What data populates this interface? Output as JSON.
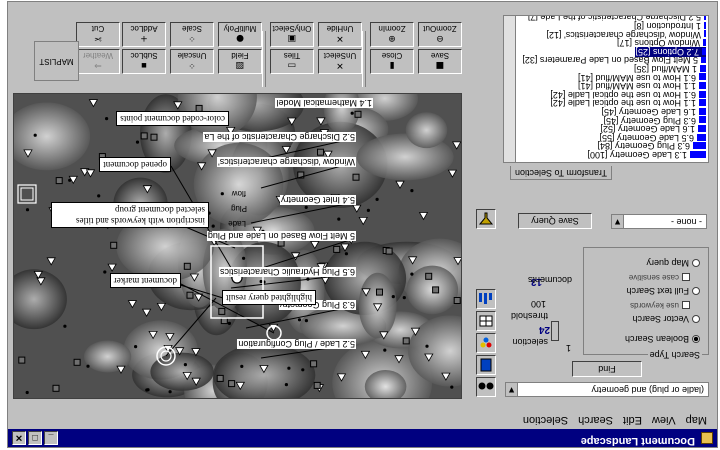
{
  "window": {
    "title": "Document Landscape"
  },
  "titlebar_buttons": {
    "minimize": "_",
    "maximize": "□",
    "close": "✕"
  },
  "menubar": {
    "items": [
      "Map",
      "View",
      "Edit",
      "Search",
      "Selection"
    ]
  },
  "landscape": {
    "doc_labels": [
      "1.4 Mathematical Model",
      "5.2 Discharge Characteristic of the La",
      "Window 'discharge characteristics'",
      "5.4 Inlet Geometry",
      "5 Melt Flow Based on Lade and Plug",
      "6.5 Plug Hydraulic Characteristics",
      "6.3 Plug Geometry",
      "5.2 Lade / Plug Configuration"
    ],
    "annotations": {
      "color_coded": "color-coded document points",
      "opened": "opened document",
      "inscription": "inscription with keywords and titles",
      "selected_group": "selected document group",
      "marker": "document marker",
      "highlighted": "highlighted query result"
    },
    "inset_labels": [
      "Lade",
      "Plug",
      "flow"
    ]
  },
  "side_icons": [
    "binoculars-icon",
    "book-icon",
    "palette-icon",
    "table-icon",
    "chart-icon",
    "filter-icon"
  ],
  "panel": {
    "query_value": "(ladle or plug) and geometry",
    "find_label": "Find",
    "search_type_title": "Search Type",
    "search_types": [
      {
        "label": "Boolean Search",
        "selected": true
      },
      {
        "label": "Vector Search",
        "selected": false
      },
      {
        "label": "Full text Search",
        "selected": false
      },
      {
        "label": "Map query",
        "selected": false
      }
    ],
    "check_keywords": "use keywords",
    "check_case": "case sensitive",
    "selection_label": "selection",
    "selection_value": "24",
    "threshold_label": "threshold",
    "threshold_value": "100",
    "documents_label": "documents",
    "documents_value": "13",
    "small_value": "1",
    "save_query_label": "Save Query",
    "none_value": "- none -",
    "tab_label": "Transform To Selection",
    "list_items": [
      {
        "label": "1.3 Lade Geometry [100]",
        "bar": 100,
        "selected": false
      },
      {
        "label": "6.3 Plug Geometry [84]",
        "bar": 84,
        "selected": false
      },
      {
        "label": "6.5 Lade Geometry [55]",
        "bar": 55,
        "selected": false
      },
      {
        "label": "1.6 Lade Geometry [52]",
        "bar": 52,
        "selected": false
      },
      {
        "label": "6.3 Plug Geometry [45]",
        "bar": 45,
        "selected": false
      },
      {
        "label": "1.6 Lade Geometry [45]",
        "bar": 45,
        "selected": false
      },
      {
        "label": "1.1 How to use the optical Ladle [42]",
        "bar": 42,
        "selected": false
      },
      {
        "label": "6.1 How to use the optical Ladle [42]",
        "bar": 42,
        "selected": false
      },
      {
        "label": "1.1 How to use MAM/flud [41]",
        "bar": 41,
        "selected": false
      },
      {
        "label": "6.1 How to use MAM/flud [41]",
        "bar": 41,
        "selected": false
      },
      {
        "label": "1 MAM/flud [35]",
        "bar": 35,
        "selected": false
      },
      {
        "label": "5 Melt Flow Based on Lade Parameters [32]",
        "bar": 32,
        "selected": false
      },
      {
        "label": "7.2 Options [25]",
        "bar": 25,
        "selected": true
      },
      {
        "label": "Window Options [17]",
        "bar": 17,
        "selected": false
      },
      {
        "label": "Window 'discharge characteristics' [12]",
        "bar": 12,
        "selected": false
      },
      {
        "label": "1 Introduction [8]",
        "bar": 8,
        "selected": false
      },
      {
        "label": "5.2 Discharge Characteristic of the Lade [7]",
        "bar": 7,
        "selected": false
      }
    ]
  },
  "toolbar": {
    "buttons": [
      {
        "id": "zoomout",
        "label": "ZoomOut",
        "icon": "⊖",
        "icon_name": "zoom-out-icon",
        "disabled": false
      },
      {
        "id": "save",
        "label": "Save",
        "icon": "■",
        "icon_name": "floppy-icon",
        "disabled": false
      },
      {
        "id": "zoomin",
        "label": "ZoomIn",
        "icon": "⊕",
        "icon_name": "zoom-in-icon",
        "disabled": false
      },
      {
        "id": "close",
        "label": "Close",
        "icon": "▮",
        "icon_name": "close-doc-icon",
        "disabled": false
      },
      {
        "id": "unhide",
        "label": "UnHide",
        "icon": "✕",
        "icon_name": "unhide-icon",
        "disabled": false
      },
      {
        "id": "unselect",
        "label": "UnSelect",
        "icon": "✕",
        "icon_name": "unselect-icon",
        "disabled": false
      },
      {
        "id": "onlyselect",
        "label": "OnlySelect",
        "icon": "▣",
        "icon_name": "only-select-icon",
        "disabled": false
      },
      {
        "id": "tiles",
        "label": "Tiles",
        "icon": "▭",
        "icon_name": "tiles-icon",
        "disabled": false
      },
      {
        "id": "multipoly",
        "label": "MultiPoly",
        "icon": "●",
        "icon_name": "multipoly-icon",
        "disabled": false
      },
      {
        "id": "field",
        "label": "Field",
        "icon": "▨",
        "icon_name": "field-icon",
        "disabled": false
      },
      {
        "id": "scale",
        "label": "Scale",
        "icon": "⁘",
        "icon_name": "scale-icon",
        "disabled": false
      },
      {
        "id": "unscale",
        "label": "Unscale",
        "icon": "⁘",
        "icon_name": "unscale-icon",
        "disabled": false
      },
      {
        "id": "addloc",
        "label": "AddLoc",
        "icon": "+",
        "icon_name": "add-location-icon",
        "disabled": false
      },
      {
        "id": "subloc",
        "label": "SubLoc",
        "icon": "▪",
        "icon_name": "sub-location-icon",
        "disabled": false
      },
      {
        "id": "cut",
        "label": "Cut",
        "icon": "✂",
        "icon_name": "scissors-icon",
        "disabled": false
      },
      {
        "id": "weather",
        "label": "Weather",
        "icon": "⇒",
        "icon_name": "weather-icon",
        "disabled": true
      }
    ],
    "maplist_label": "MAPLIST"
  },
  "colors": {
    "title_bg": "#000080",
    "face": "#c0c0c0",
    "bar": "#0000ff",
    "selection": "#000080"
  }
}
